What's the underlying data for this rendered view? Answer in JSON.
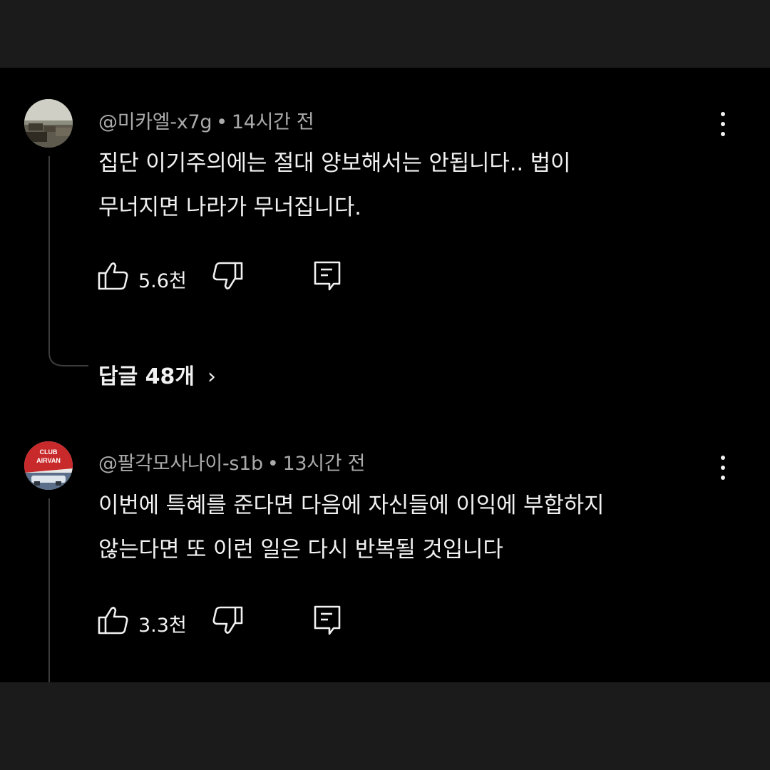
{
  "comments": [
    {
      "author": "@미카엘-x7g",
      "separator": "•",
      "time": "14시간 전",
      "lines": [
        "집단 이기주의에는 절대 양보해서는 안됩니다.. 법이",
        "무너지면 나라가 무너집니다."
      ],
      "likes": "5.6천",
      "avatar_icon": "landscape-avatar-icon",
      "replies_label": "답글 48개",
      "replies_chevron": "›"
    },
    {
      "author": "@팔각모사나이-s1b",
      "separator": "•",
      "time": "13시간 전",
      "lines": [
        "이번에 특혜를 준다면 다음에 자신들에 이익에 부합하지",
        "않는다면 또 이런 일은 다시 반복될 것입니다"
      ],
      "likes": "3.3천",
      "avatar_icon": "club-badge-avatar-icon",
      "avatar_text": [
        "CLUB",
        "AIRVAN"
      ]
    }
  ],
  "colors": {
    "background": "#000000",
    "frame": "#1b1b1b",
    "text": "#f1f1f1",
    "meta": "#aaaaaa",
    "thread": "#3c3c3c"
  }
}
